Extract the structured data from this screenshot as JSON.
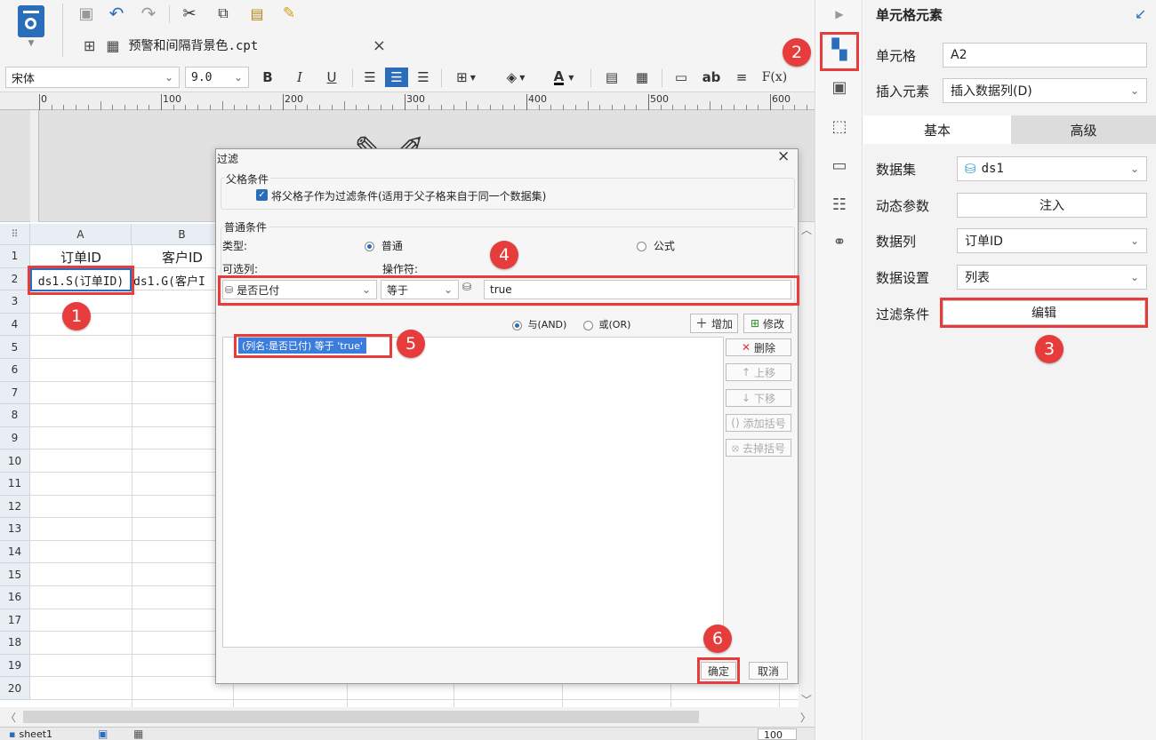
{
  "toolbar": {
    "font_name": "宋体",
    "font_size": "9.0",
    "bold": "B",
    "italic": "I",
    "underline": "U",
    "text_ab": "ab",
    "formula": "F(x)"
  },
  "tab": {
    "title": "预警和间隔背景色.cpt",
    "close": "×"
  },
  "ruler": {
    "ticks": [
      "0",
      "100",
      "200",
      "300",
      "400",
      "500",
      "600"
    ]
  },
  "sheet": {
    "columns": [
      "A",
      "B"
    ],
    "rows": [
      "1",
      "2",
      "3",
      "4",
      "5",
      "6",
      "7",
      "8",
      "9",
      "10",
      "11",
      "12",
      "13",
      "14",
      "15",
      "16",
      "17",
      "18",
      "19",
      "20"
    ],
    "cell_a1": "订单ID",
    "cell_b1": "客户ID",
    "cell_a2": "ds1.S(订单ID)",
    "cell_b2": "ds1.G(客户I",
    "tab_name": "sheet1",
    "zoom": "100"
  },
  "dialog": {
    "title": "过滤",
    "close": "×",
    "parent_section": "父格条件",
    "parent_checkbox": "将父格子作为过滤条件(适用于父子格来自于同一个数据集)",
    "normal_section": "普通条件",
    "type_label": "类型:",
    "type_normal": "普通",
    "type_formula": "公式",
    "column_label": "可选列:",
    "operator_label": "操作符:",
    "column_value": "是否已付",
    "operator_value": "等于",
    "value": "true",
    "and_label": "与(AND)",
    "or_label": "或(OR)",
    "add_button": "增加",
    "modify_button": "修改",
    "delete_button": "删除",
    "up_button": "上移",
    "down_button": "下移",
    "add_bracket_button": "添加括号",
    "remove_bracket_button": "去掉括号",
    "condition_item": "(列名:是否已付) 等于 'true'",
    "ok_button": "确定",
    "cancel_button": "取消"
  },
  "right_panel": {
    "header": "单元格元素",
    "cell_label": "单元格",
    "cell_value": "A2",
    "insert_label": "插入元素",
    "insert_value": "插入数据列(D)",
    "tab_basic": "基本",
    "tab_advanced": "高级",
    "dataset_label": "数据集",
    "dataset_value": "ds1",
    "param_label": "动态参数",
    "param_button": "注入",
    "column_label": "数据列",
    "column_value": "订单ID",
    "setting_label": "数据设置",
    "setting_value": "列表",
    "filter_label": "过滤条件",
    "filter_button": "编辑"
  },
  "badges": [
    "1",
    "2",
    "3",
    "4",
    "5",
    "6"
  ],
  "colors": {
    "accent_blue": "#2a6ebb",
    "annotation_red": "#e63c3c",
    "selected_item": "#3b7ddd"
  }
}
